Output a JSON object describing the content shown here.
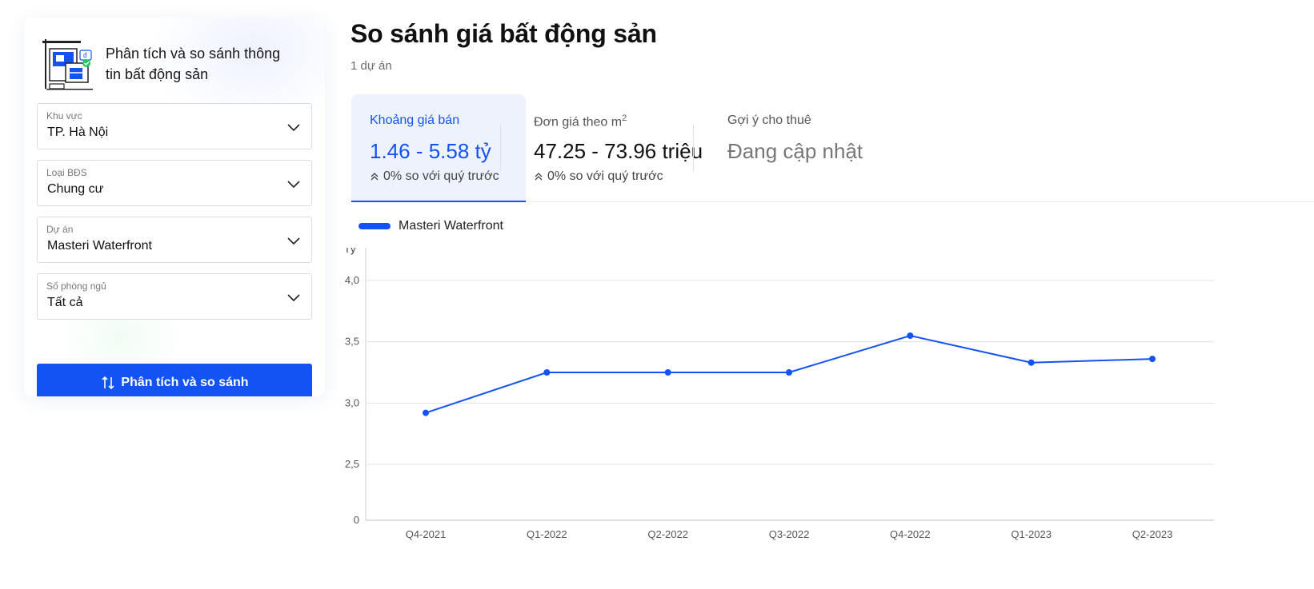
{
  "sidebar": {
    "brand_title": "Phân tích và so sánh thông tin bất động sản",
    "fields": [
      {
        "label": "Khu vực",
        "value": "TP. Hà Nội"
      },
      {
        "label": "Loại BĐS",
        "value": "Chung cư"
      },
      {
        "label": "Dự án",
        "value": "Masteri Waterfront"
      },
      {
        "label": "Số phòng ngủ",
        "value": "Tất cả"
      }
    ],
    "cta_label": "Phân tích và so sánh"
  },
  "main": {
    "title": "So sánh giá bất động sản",
    "subtitle": "1 dự án",
    "tabs": [
      {
        "label": "Khoảng giá bán",
        "value": "1.46 - 5.58 tỷ",
        "change": "0% so với quý trước",
        "active": true
      },
      {
        "label": "Đơn giá theo m",
        "label_sup": "2",
        "value": "47.25 - 73.96 triệu",
        "change": "0% so với quý trước",
        "active": false
      },
      {
        "label": "Gợi ý cho thuê",
        "value": "Đang cập nhật",
        "active": false
      }
    ]
  },
  "colors": {
    "accent": "#1453f3",
    "active_tab_bg": "#eef2fd",
    "grid": "#e3e3e3"
  },
  "chart_data": {
    "type": "line",
    "ylabel": "Tỷ",
    "categories": [
      "Q4-2021",
      "Q1-2022",
      "Q2-2022",
      "Q3-2022",
      "Q4-2022",
      "Q1-2023",
      "Q2-2023"
    ],
    "series": [
      {
        "name": "Masteri Waterfront",
        "values": [
          2.92,
          3.25,
          3.25,
          3.25,
          3.55,
          3.33,
          3.36
        ]
      }
    ],
    "yticks": [
      {
        "value": 0,
        "label": "0"
      },
      {
        "value": 2.5,
        "label": "2,5"
      },
      {
        "value": 3.0,
        "label": "3,0"
      },
      {
        "value": 3.5,
        "label": "3,5"
      },
      {
        "value": 4.0,
        "label": "4,0"
      }
    ],
    "ylim": [
      2.1,
      4.0
    ],
    "legend": "top-left",
    "grid": true
  }
}
